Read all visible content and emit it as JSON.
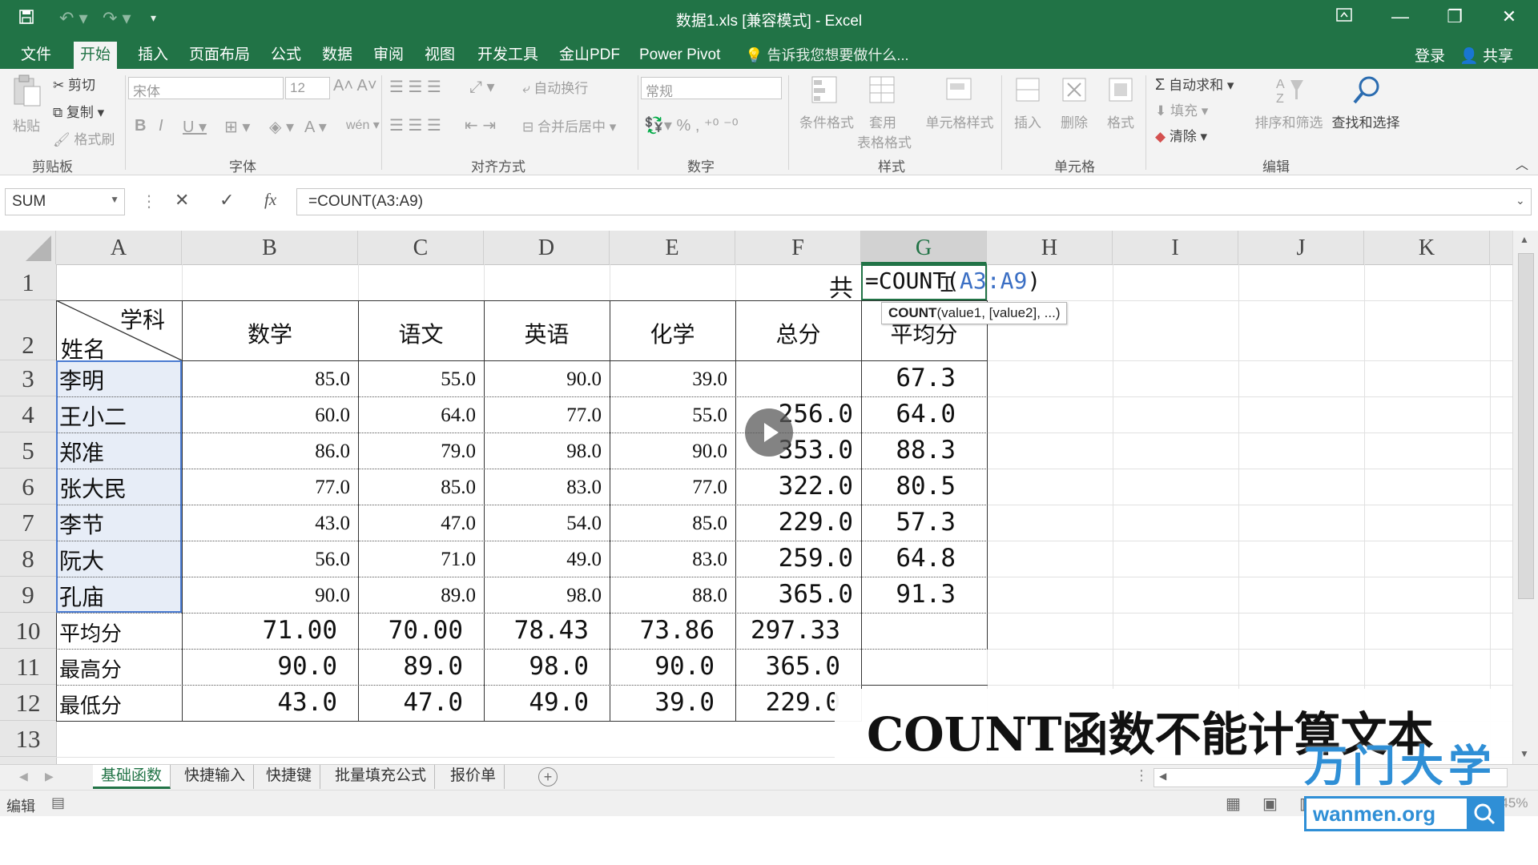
{
  "window": {
    "title": "数据1.xls  [兼容模式] - Excel",
    "login": "登录",
    "share": "共享"
  },
  "tabs": [
    "文件",
    "开始",
    "插入",
    "页面布局",
    "公式",
    "数据",
    "审阅",
    "视图",
    "开发工具",
    "金山PDF",
    "Power Pivot"
  ],
  "tell_me": "告诉我您想要做什么...",
  "ribbon": {
    "clipboard": {
      "paste": "粘贴",
      "cut": "剪切",
      "copy": "复制",
      "format_painter": "格式刷",
      "group": "剪贴板"
    },
    "font": {
      "name": "宋体",
      "size": "12",
      "group": "字体"
    },
    "align": {
      "wrap": "自动换行",
      "merge": "合并后居中",
      "group": "对齐方式"
    },
    "number": {
      "format": "常规",
      "group": "数字"
    },
    "styles": {
      "cond": "条件格式",
      "table_1": "套用",
      "table_2": "表格格式",
      "cell_styles": "单元格样式",
      "group": "样式"
    },
    "cells": {
      "insert": "插入",
      "delete": "删除",
      "format": "格式",
      "group": "单元格"
    },
    "editing": {
      "autosum": "自动求和",
      "fill": "填充",
      "clear": "清除",
      "sort": "排序和筛选",
      "find": "查找和选择",
      "group": "编辑"
    }
  },
  "formula_bar": {
    "name_box": "SUM",
    "formula": "=COUNT(A3:A9)"
  },
  "columns": [
    "A",
    "B",
    "C",
    "D",
    "E",
    "F",
    "G",
    "H",
    "I",
    "J",
    "K"
  ],
  "rows": [
    "1",
    "2",
    "3",
    "4",
    "5",
    "6",
    "7",
    "8",
    "9",
    "10",
    "11",
    "12",
    "13"
  ],
  "sheet": {
    "f1": "共",
    "g1_prefix": "=COUNT(",
    "g1_ref": "A3:A9",
    "g1_suffix": ")",
    "tooltip_fn": "COUNT",
    "tooltip_args": "(value1, [value2], ...)",
    "corner_top": "学科",
    "corner_bottom": "姓名",
    "headers": [
      "数学",
      "语文",
      "英语",
      "化学",
      "总分",
      "平均分"
    ],
    "students": [
      {
        "name": "李明",
        "scores": [
          "85.0",
          "55.0",
          "90.0",
          "39.0"
        ],
        "total": "",
        "avg": "67.3"
      },
      {
        "name": "王小二",
        "scores": [
          "60.0",
          "64.0",
          "77.0",
          "55.0"
        ],
        "total": "256.0",
        "avg": "64.0"
      },
      {
        "name": "郑准",
        "scores": [
          "86.0",
          "79.0",
          "98.0",
          "90.0"
        ],
        "total": "353.0",
        "avg": "88.3"
      },
      {
        "name": "张大民",
        "scores": [
          "77.0",
          "85.0",
          "83.0",
          "77.0"
        ],
        "total": "322.0",
        "avg": "80.5"
      },
      {
        "name": "李节",
        "scores": [
          "43.0",
          "47.0",
          "54.0",
          "85.0"
        ],
        "total": "229.0",
        "avg": "57.3"
      },
      {
        "name": "阮大",
        "scores": [
          "56.0",
          "71.0",
          "49.0",
          "83.0"
        ],
        "total": "259.0",
        "avg": "64.8"
      },
      {
        "name": "孔庙",
        "scores": [
          "90.0",
          "89.0",
          "98.0",
          "88.0"
        ],
        "total": "365.0",
        "avg": "91.3"
      }
    ],
    "summary": [
      {
        "label": "平均分",
        "values": [
          "71.00",
          "70.00",
          "78.43",
          "73.86",
          "297.33"
        ]
      },
      {
        "label": "最高分",
        "values": [
          "90.0",
          "89.0",
          "98.0",
          "90.0",
          "365.0"
        ]
      },
      {
        "label": "最低分",
        "values": [
          "43.0",
          "47.0",
          "49.0",
          "39.0",
          "229.0"
        ]
      }
    ]
  },
  "sheet_tabs": [
    "基础函数",
    "快捷输入",
    "快捷键",
    "批量填充公式",
    "报价单"
  ],
  "status": {
    "mode": "编辑",
    "zoom": "145%"
  },
  "overlay": {
    "caption": "COUNT函数不能计算文本",
    "brand": "万门大学",
    "url": "wanmen.org"
  },
  "colors": {
    "accent": "#217346",
    "selection_fill": "#e7edf7",
    "ref_blue": "#3b6fc4",
    "brand_blue": "#2f8fd6"
  }
}
